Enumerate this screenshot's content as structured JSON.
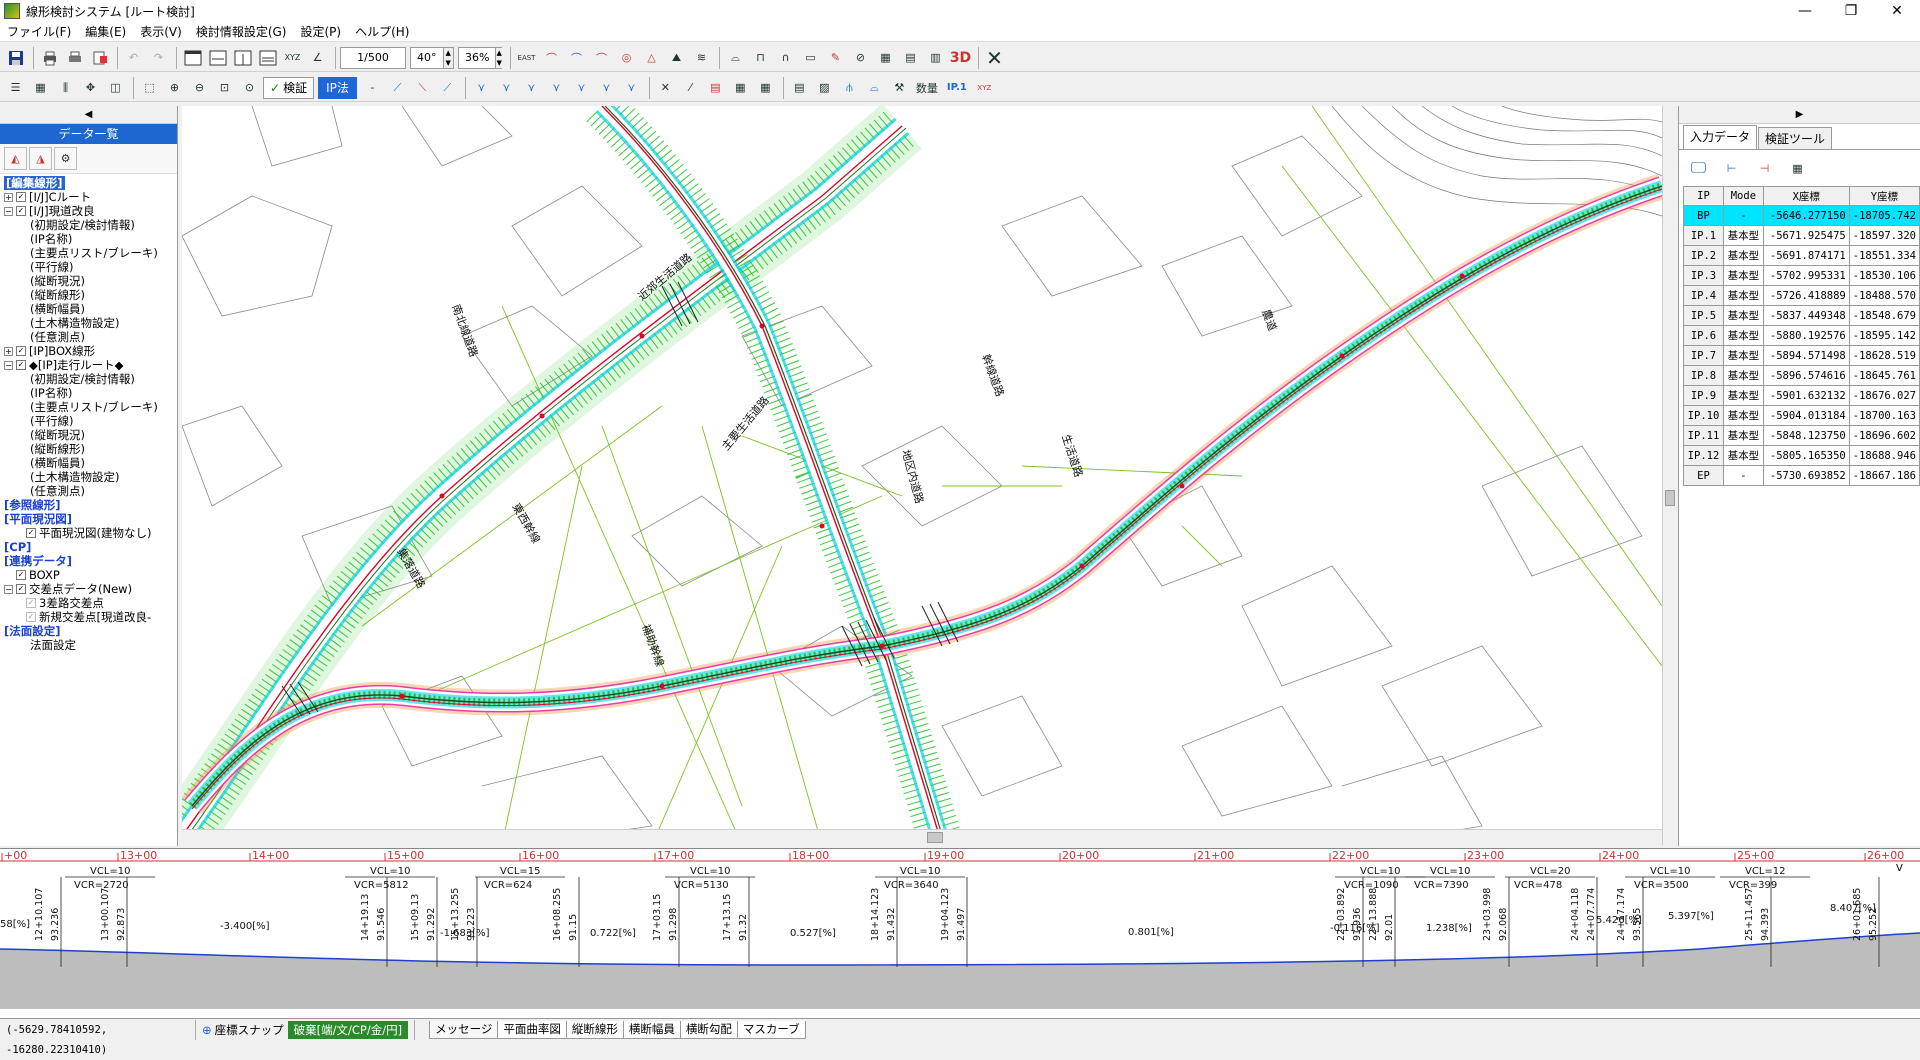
{
  "window": {
    "title": "線形検討システム [ルート検討]",
    "minimize": "—",
    "restore": "❐",
    "close": "✕"
  },
  "menu": [
    "ファイル(F)",
    "編集(E)",
    "表示(V)",
    "検討情報設定(G)",
    "設定(P)",
    "ヘルプ(H)"
  ],
  "toolbar": {
    "scale": "1/500",
    "angle": "40°",
    "percent": "36%",
    "check_label": "検証",
    "ip_method_label": "IP法",
    "count_label": "数量",
    "ip1_label": "IP.1",
    "view3d_label": "3D"
  },
  "left_panel": {
    "title": "データ一覧",
    "tree": [
      {
        "type": "section",
        "label": "[編集線形]",
        "highlight": true
      },
      {
        "type": "node",
        "indent": 0,
        "expander": "+",
        "check": "✓",
        "label": "[I/J]Cルート"
      },
      {
        "type": "node",
        "indent": 0,
        "expander": "−",
        "check": "✓",
        "label": "[I/J]現道改良"
      },
      {
        "type": "leaf",
        "indent": 1,
        "label": "(初期設定/検討情報)"
      },
      {
        "type": "leaf",
        "indent": 1,
        "label": "(IP名称)"
      },
      {
        "type": "leaf",
        "indent": 1,
        "label": "(主要点リスト/ブレーキ)"
      },
      {
        "type": "leaf",
        "indent": 1,
        "label": "(平行線)"
      },
      {
        "type": "leaf",
        "indent": 1,
        "label": "(縦断現況)"
      },
      {
        "type": "leaf",
        "indent": 1,
        "label": "(縦断線形)"
      },
      {
        "type": "leaf",
        "indent": 1,
        "label": "(横断幅員)"
      },
      {
        "type": "leaf",
        "indent": 1,
        "label": "(土木構造物設定)"
      },
      {
        "type": "leaf",
        "indent": 1,
        "label": "(任意測点)"
      },
      {
        "type": "node",
        "indent": 0,
        "expander": "+",
        "check": "✓",
        "label": "[IP]BOX線形"
      },
      {
        "type": "node",
        "indent": 0,
        "expander": "−",
        "check": "✓",
        "label": "◆[IP]走行ルート◆"
      },
      {
        "type": "leaf",
        "indent": 1,
        "label": "(初期設定/検討情報)"
      },
      {
        "type": "leaf",
        "indent": 1,
        "label": "(IP名称)"
      },
      {
        "type": "leaf",
        "indent": 1,
        "label": "(主要点リスト/ブレーキ)"
      },
      {
        "type": "leaf",
        "indent": 1,
        "label": "(平行線)"
      },
      {
        "type": "leaf",
        "indent": 1,
        "label": "(縦断現況)"
      },
      {
        "type": "leaf",
        "indent": 1,
        "label": "(縦断線形)"
      },
      {
        "type": "leaf",
        "indent": 1,
        "label": "(横断幅員)"
      },
      {
        "type": "leaf",
        "indent": 1,
        "label": "(土木構造物設定)"
      },
      {
        "type": "leaf",
        "indent": 1,
        "label": "(任意測点)"
      },
      {
        "type": "section",
        "label": "[参照線形]"
      },
      {
        "type": "section",
        "label": "[平面現況図]"
      },
      {
        "type": "node",
        "indent": 1,
        "expander": "",
        "check": "✓",
        "label": "平面現況図(建物なし)"
      },
      {
        "type": "section",
        "label": "[CP]"
      },
      {
        "type": "section",
        "label": "[連携データ]"
      },
      {
        "type": "node",
        "indent": 0,
        "expander": "",
        "check": "✓",
        "label": "BOXP"
      },
      {
        "type": "node",
        "indent": 0,
        "expander": "−",
        "check": "✓",
        "label": "交差点データ(New)"
      },
      {
        "type": "node",
        "indent": 1,
        "expander": "",
        "check": "✓",
        "disabled": true,
        "label": "3差路交差点"
      },
      {
        "type": "node",
        "indent": 1,
        "expander": "",
        "check": "✓",
        "disabled": true,
        "label": "新規交差点[現道改良-"
      },
      {
        "type": "section",
        "label": "[法面設定]"
      },
      {
        "type": "leaf",
        "indent": 1,
        "label": "法面設定"
      }
    ]
  },
  "right_panel": {
    "tabs": [
      "入力データ",
      "検証ツール"
    ],
    "table": {
      "headers": [
        "IP",
        "Mode",
        "X座標",
        "Y座標"
      ],
      "rows": [
        [
          "BP",
          "-",
          "-5646.277150",
          "-18705.742"
        ],
        [
          "IP.1",
          "基本型",
          "-5671.925475",
          "-18597.320"
        ],
        [
          "IP.2",
          "基本型",
          "-5691.874171",
          "-18551.334"
        ],
        [
          "IP.3",
          "基本型",
          "-5702.995331",
          "-18530.106"
        ],
        [
          "IP.4",
          "基本型",
          "-5726.418889",
          "-18488.570"
        ],
        [
          "IP.5",
          "基本型",
          "-5837.449348",
          "-18548.679"
        ],
        [
          "IP.6",
          "基本型",
          "-5880.192576",
          "-18595.142"
        ],
        [
          "IP.7",
          "基本型",
          "-5894.571498",
          "-18628.519"
        ],
        [
          "IP.8",
          "基本型",
          "-5896.574616",
          "-18645.761"
        ],
        [
          "IP.9",
          "基本型",
          "-5901.632132",
          "-18676.027"
        ],
        [
          "IP.10",
          "基本型",
          "-5904.013184",
          "-18700.163"
        ],
        [
          "IP.11",
          "基本型",
          "-5848.123750",
          "-18696.602"
        ],
        [
          "IP.12",
          "基本型",
          "-5805.165350",
          "-18688.946"
        ],
        [
          "EP",
          "-",
          "-5730.693852",
          "-18667.186"
        ]
      ]
    }
  },
  "map": {
    "labels": [
      "南北線道路",
      "近郊生活道路",
      "東西幹線",
      "主要生活道路",
      "地区内道路",
      "集落道路",
      "幹線道路",
      "生活道路",
      "農道",
      "補助幹線"
    ]
  },
  "profile": {
    "stations": [
      "+00",
      "13+00",
      "14+00",
      "15+00",
      "16+00",
      "17+00",
      "18+00",
      "19+00",
      "20+00",
      "21+00",
      "22+00",
      "23+00",
      "24+00",
      "25+00",
      "26+00"
    ],
    "vcl": [
      "VCL=10",
      "VCL=10",
      "VCL=15",
      "VCL=10",
      "VCL=10",
      "VCL=10",
      "VCL=10",
      "VCL=20",
      "VCL=10",
      "VCL=12"
    ],
    "vcr": [
      "VCR=2720",
      "VCR=5812",
      "VCR=624",
      "VCR=5130",
      "VCR=3640",
      "VCR=1090",
      "VCR=7390",
      "VCR=478",
      "VCR=3500",
      "VCR=399"
    ],
    "vert_labels": [
      "12+10.107",
      "93.236",
      "13+00.107",
      "92.873",
      "14+19.13",
      "91.546",
      "15+09.13",
      "91.292",
      "15+13.255",
      "91.223",
      "16+08.255",
      "91.15",
      "17+03.15",
      "91.298",
      "17+13.15",
      "91.32",
      "18+14.123",
      "91.432",
      "19+04.123",
      "91.497",
      "22+03.892",
      "91.936",
      "22+13.888",
      "92.01",
      "23+03.998",
      "92.068",
      "24+04.118",
      "24+07.774",
      "24+17.174",
      "93.565",
      "25+11.457",
      "94.393",
      "26+01.685",
      "95.252"
    ],
    "grades": [
      "-3.400[%]",
      "-1.683[%]",
      "0.722[%]",
      "0.527[%]",
      "0.801[%]",
      "-0.116[%]",
      "1.238[%]",
      "5.426[%]",
      "5.397[%]",
      "8.407[%]"
    ],
    "edge_grade": "58[%]",
    "v_label": "V"
  },
  "status": {
    "coords": "(-5629.78410592, -16280.22310410)",
    "snap_icon": "target-icon",
    "snap": "座標スナップ",
    "mode": "破棄[端/文/CP/金/円]",
    "tabs": [
      "メッセージ",
      "平面曲率図",
      "縦断線形",
      "横断幅員",
      "横断勾配",
      "マスカーブ"
    ]
  },
  "colors": {
    "accent": "#1e66d0",
    "road_green": "#27c427",
    "road_cyan": "#00d0e0",
    "road_red": "#e0002a",
    "road_pink": "#e83caa",
    "road_orange": "#f08a2c",
    "selected_row": "#00e5ff",
    "mode_green": "#2b8a2b"
  }
}
